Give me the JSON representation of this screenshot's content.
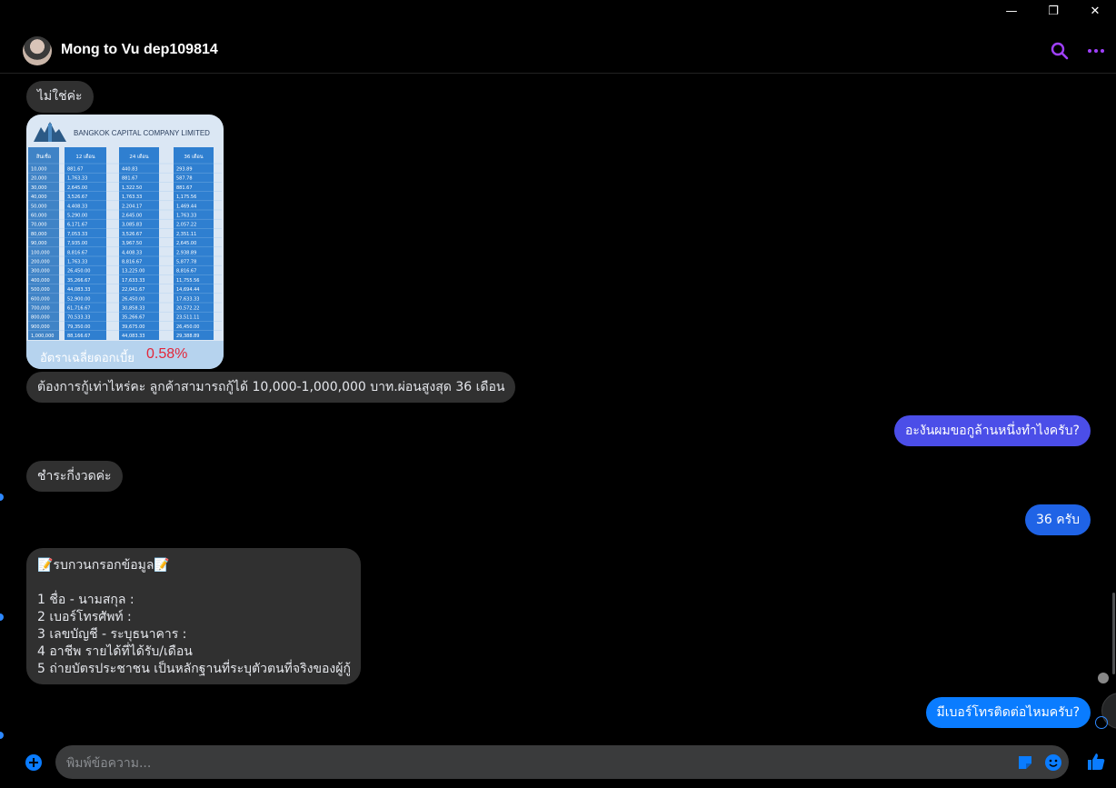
{
  "window": {
    "minimize": "—",
    "restore": "❐",
    "close": "✕"
  },
  "header": {
    "contact_name": "Mong to Vu dep109814"
  },
  "colors": {
    "outgoing_a": "#4b4ee8",
    "outgoing_b": "#0a7cff",
    "incoming": "#303030",
    "accent": "#a040ff"
  },
  "messages": {
    "m1": "ไม่ใช่ค่ะ",
    "image": {
      "company": "BANGKOK CAPITAL COMPANY LIMITED",
      "col_headers": [
        "สินเชื่อ",
        "12 เดือน",
        "24 เดือน",
        "36 เดือน"
      ],
      "rows": [
        [
          "10,000",
          "881.67",
          "440.83",
          "293.89"
        ],
        [
          "20,000",
          "1,763.33",
          "881.67",
          "587.78"
        ],
        [
          "30,000",
          "2,645.00",
          "1,322.50",
          "881.67"
        ],
        [
          "40,000",
          "3,526.67",
          "1,763.33",
          "1,175.56"
        ],
        [
          "50,000",
          "4,408.33",
          "2,204.17",
          "1,469.44"
        ],
        [
          "60,000",
          "5,290.00",
          "2,645.00",
          "1,763.33"
        ],
        [
          "70,000",
          "6,171.67",
          "3,085.83",
          "2,057.22"
        ],
        [
          "80,000",
          "7,053.33",
          "3,526.67",
          "2,351.11"
        ],
        [
          "90,000",
          "7,935.00",
          "3,967.50",
          "2,645.00"
        ],
        [
          "100,000",
          "8,816.67",
          "4,408.33",
          "2,938.89"
        ],
        [
          "200,000",
          "1,763.33",
          "8,816.67",
          "5,877.78"
        ],
        [
          "300,000",
          "26,450.00",
          "13,225.00",
          "8,816.67"
        ],
        [
          "400,000",
          "35,266.67",
          "17,633.33",
          "11,755.56"
        ],
        [
          "500,000",
          "44,083.33",
          "22,041.67",
          "14,694.44"
        ],
        [
          "600,000",
          "52,900.00",
          "26,450.00",
          "17,633.33"
        ],
        [
          "700,000",
          "61,716.67",
          "30,858.33",
          "20,572.22"
        ],
        [
          "800,000",
          "70,533.33",
          "35,266.67",
          "23,511.11"
        ],
        [
          "900,000",
          "79,350.00",
          "39,675.00",
          "26,450.00"
        ],
        [
          "1,000,000",
          "88,166.67",
          "44,083.33",
          "29,388.89"
        ]
      ],
      "rate_label": "อัตราเฉลี่ยดอกเบี้ย",
      "rate_value": "0.58%"
    },
    "m2": "ต้องการกู้เท่าไหร่คะ ลูกค้าสามารถกู้ได้ 10,000-1,000,000 บาท.ผ่อนสูงสุด 36 เดือน",
    "m3": "อะงันผมขอกูล้านหนึ่งทำไงครับ?",
    "m4": "ชำระกี่งวดค่ะ",
    "m5": "36 ครับ",
    "form": {
      "line0": "📝รบกวนกรอกข้อมูล📝",
      "line1": "",
      "line2": "1 ชื่อ - นามสกุล :",
      "line3": "2 เบอร์โทรศัพท์ :",
      "line4": "3 เลขบัญชี - ระบุธนาคาร :",
      "line5": "4 อาชีพ รายได้ที่ได้รับ/เดือน",
      "line6": "5 ถ่ายบัตรประชาชน  เป็นหลักฐานที่ระบุตัวตนที่จริงของผู้กู้"
    },
    "m6": "มีเบอร์โทรติดต่อไหมครับ?"
  },
  "composer": {
    "placeholder": "พิมพ์ข้อความ..."
  }
}
